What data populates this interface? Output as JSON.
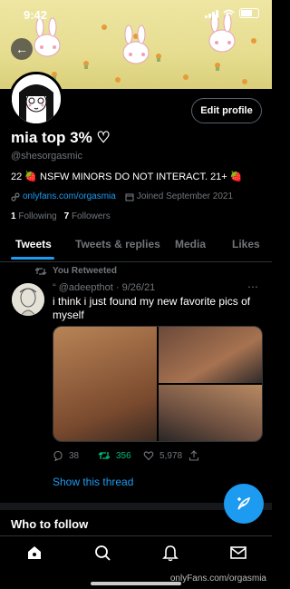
{
  "status": {
    "time": "9:42"
  },
  "profile": {
    "name": "mia top 3% ♡",
    "handle": "@shesorgasmic",
    "bio": "22 🍓 NSFW MINORS DO NOT INTERACT. 21+ 🍓",
    "link": "onlyfans.com/orgasmia",
    "joined": "Joined September 2021",
    "following_count": "1",
    "following_label": "Following",
    "followers_count": "7",
    "followers_label": "Followers",
    "edit_label": "Edit profile"
  },
  "tabs": [
    {
      "label": "Tweets"
    },
    {
      "label": "Tweets & replies"
    },
    {
      "label": "Media"
    },
    {
      "label": "Likes"
    }
  ],
  "tweet": {
    "retweet_note": "You Retweeted",
    "author": "“ @adeepthot · 9/26/21",
    "text": "i think i just found my new favorite pics of myself",
    "reply_count": "38",
    "retweet_count": "356",
    "like_count": "5,978",
    "show_thread": "Show this thread"
  },
  "who_to_follow": "Who to follow",
  "watermark": "onlyFans.com/orgasmia",
  "colors": {
    "accent": "#1d9bf0",
    "retweet": "#00ba7c",
    "muted": "#71767b"
  }
}
